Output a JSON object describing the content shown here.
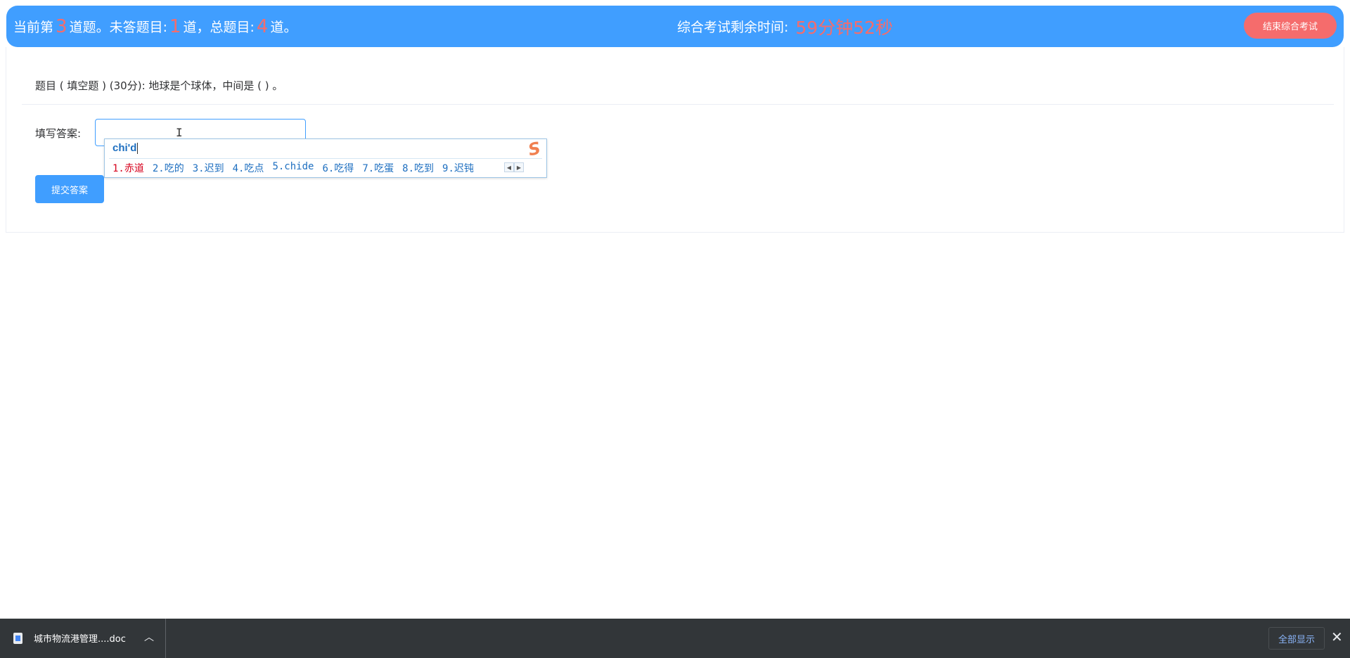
{
  "header": {
    "progress_prefix": "当前第",
    "current_number": "3",
    "progress_mid1": "道题。未答题目:",
    "unanswered_number": "1",
    "progress_mid2": "道，总题目:",
    "total_number": "4",
    "progress_suffix": "道。",
    "timer_label": "综合考试剩余时间:",
    "timer_value": "59分钟52秒",
    "end_button_label": "结束综合考试"
  },
  "question": {
    "text": "题目 ( 填空题 ) (30分):  地球是个球体，中间是 ( ) 。",
    "answer_label": "填写答案:",
    "answer_value": "",
    "submit_label": "提交答案"
  },
  "ime": {
    "pinyin": "chi'd",
    "candidates": [
      "1.赤道",
      "2.吃的",
      "3.迟到",
      "4.吃点",
      "5.chide",
      "6.吃得",
      "7.吃蛋",
      "8.吃到",
      "9.迟钝"
    ],
    "logo_letter": "S"
  },
  "download_bar": {
    "file_name": "城市物流港管理....doc",
    "show_all_label": "全部显示"
  },
  "colors": {
    "primary": "#409eff",
    "danger": "#f56c6c",
    "ime_blue": "#1e6fc0",
    "ime_active": "#d6001c"
  }
}
